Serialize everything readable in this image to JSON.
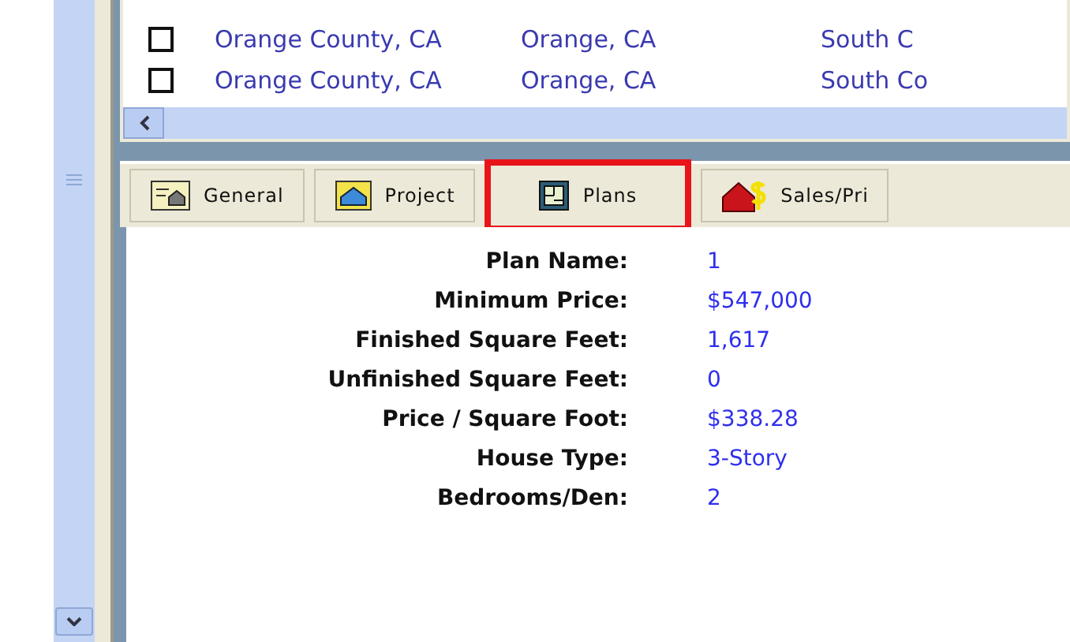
{
  "list": {
    "rows": [
      {
        "checked": false,
        "cells": [
          "Orange County, CA",
          "Orange, CA",
          "South C"
        ]
      },
      {
        "checked": false,
        "cells": [
          "Orange County, CA",
          "Orange, CA",
          "South Co"
        ]
      }
    ]
  },
  "tabs": [
    {
      "label": "General",
      "kind": "general",
      "highlighted": false
    },
    {
      "label": "Project",
      "kind": "project",
      "highlighted": false
    },
    {
      "label": "Plans",
      "kind": "plans",
      "highlighted": true
    },
    {
      "label": "Sales/Pri",
      "kind": "sales",
      "highlighted": false
    }
  ],
  "details": [
    {
      "label": "Plan Name:",
      "value": "1"
    },
    {
      "label": "Minimum Price:",
      "value": "$547,000"
    },
    {
      "label": "Finished Square Feet:",
      "value": "1,617"
    },
    {
      "label": "Unfinished Square Feet:",
      "value": "0"
    },
    {
      "label": "Price / Square Foot:",
      "value": "$338.28"
    },
    {
      "label": "House Type:",
      "value": "3-Story"
    },
    {
      "label": "Bedrooms/Den:",
      "value": "2"
    }
  ]
}
